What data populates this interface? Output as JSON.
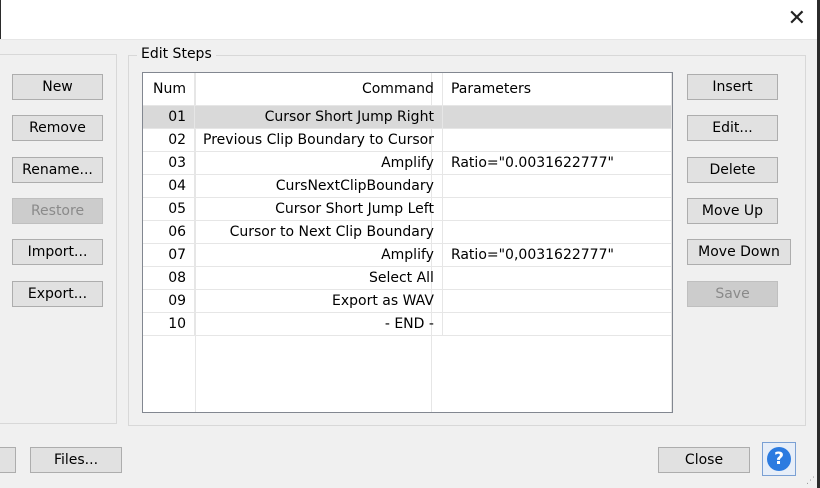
{
  "window": {
    "close_glyph": "✕"
  },
  "left_buttons": [
    {
      "label": "New",
      "enabled": true
    },
    {
      "label": "Remove",
      "enabled": true
    },
    {
      "label": "Rename...",
      "enabled": true
    },
    {
      "label": "Restore",
      "enabled": false
    },
    {
      "label": "Import...",
      "enabled": true
    },
    {
      "label": "Export...",
      "enabled": true
    }
  ],
  "edit_steps": {
    "group_label": "Edit Steps",
    "columns": [
      "Num",
      "Command",
      "Parameters"
    ],
    "rows": [
      {
        "num": "01",
        "command": "Cursor Short Jump Right",
        "params": "",
        "selected": true
      },
      {
        "num": "02",
        "command": "Previous Clip Boundary to Cursor",
        "params": ""
      },
      {
        "num": "03",
        "command": "Amplify",
        "params": "Ratio=\"0.0031622777\""
      },
      {
        "num": "04",
        "command": "CursNextClipBoundary",
        "params": ""
      },
      {
        "num": "05",
        "command": "Cursor Short Jump Left",
        "params": ""
      },
      {
        "num": "06",
        "command": "Cursor to Next Clip Boundary",
        "params": ""
      },
      {
        "num": "07",
        "command": "Amplify",
        "params": "Ratio=\"0,0031622777\""
      },
      {
        "num": "08",
        "command": "Select All",
        "params": ""
      },
      {
        "num": "09",
        "command": "Export as WAV",
        "params": ""
      },
      {
        "num": "10",
        "command": "- END -",
        "params": ""
      }
    ]
  },
  "right_buttons": [
    {
      "label": "Insert",
      "enabled": true
    },
    {
      "label": "Edit...",
      "enabled": true
    },
    {
      "label": "Delete",
      "enabled": true
    },
    {
      "label": "Move Up",
      "enabled": true
    },
    {
      "label": "Move Down",
      "enabled": true
    },
    {
      "label": "Save",
      "enabled": false
    }
  ],
  "footer": {
    "files_label": "Files...",
    "close_label": "Close",
    "help_glyph": "?"
  }
}
